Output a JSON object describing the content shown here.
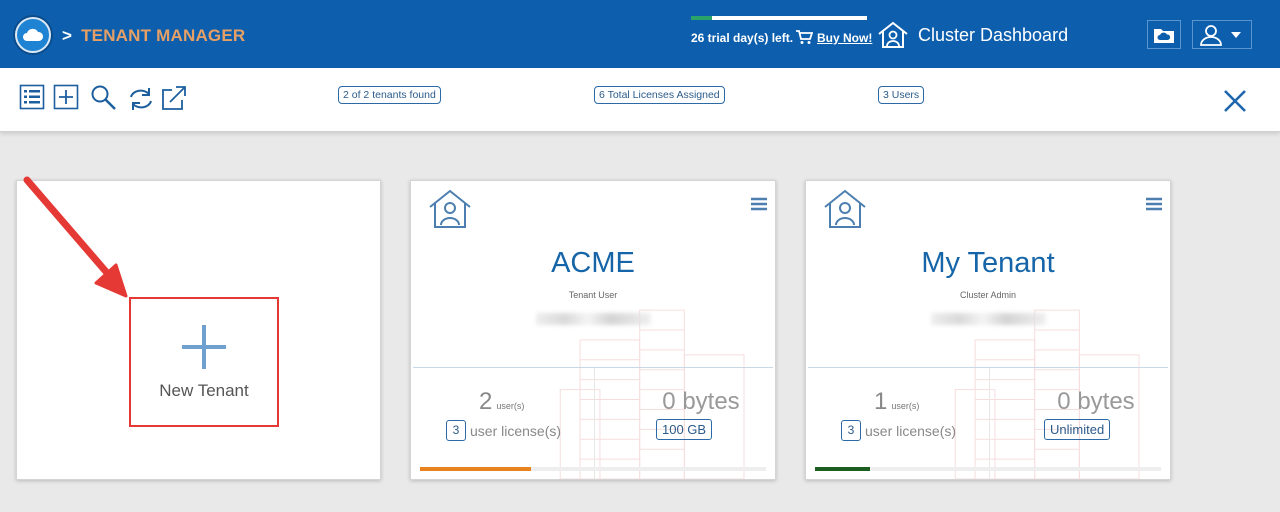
{
  "header": {
    "breadcrumb_sep": ">",
    "title": "TENANT MANAGER",
    "trial_text": "26 trial day(s) left.",
    "trial_progress": 0.12,
    "buy_now": "Buy Now!",
    "cluster_dashboard": "Cluster Dashboard",
    "icons": [
      "cloud-logo-icon",
      "shopping-cart-icon",
      "cluster-home-icon",
      "cloud-folder-icon",
      "user-dropdown-icon"
    ]
  },
  "toolbar": {
    "icons": [
      "list-view-icon",
      "add-icon",
      "search-icon",
      "refresh-icon",
      "export-icon",
      "close-icon"
    ],
    "tenants_found": "2 of 2 tenants found",
    "licenses_assigned": "6 Total Licenses Assigned",
    "users_count": "3 Users"
  },
  "new_tenant": {
    "label": "New Tenant"
  },
  "tenants": [
    {
      "name": "ACME",
      "role": "Tenant User",
      "users": "2",
      "users_unit": "user(s)",
      "licenses": "3",
      "license_label": "user license(s)",
      "storage": "0 bytes",
      "quota": "100 GB",
      "bar_color": "#e8821e",
      "bar_fill": 0.32
    },
    {
      "name": "My Tenant",
      "role": "Cluster Admin",
      "users": "1",
      "users_unit": "user(s)",
      "licenses": "3",
      "license_label": "user license(s)",
      "storage": "0 bytes",
      "quota": "Unlimited",
      "bar_color": "#1b5e20",
      "bar_fill": 0.16
    }
  ],
  "colors": {
    "header_bg": "#0d5fae",
    "breadcrumb": "#e6a066",
    "accent": "#1565a8",
    "annotation": "#e53935"
  }
}
